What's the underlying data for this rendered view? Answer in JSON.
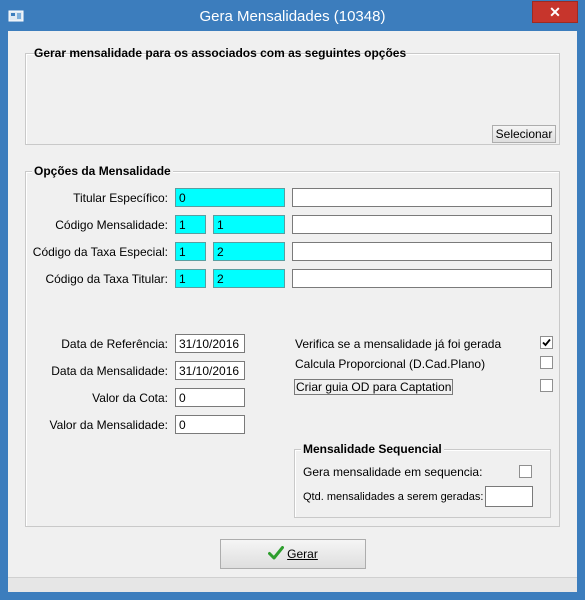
{
  "window": {
    "title": "Gera Mensalidades (10348)",
    "close_glyph": "✕"
  },
  "group_associados": {
    "legend": "Gerar mensalidade para os associados com as seguintes opções",
    "selecionar_label": "Selecionar"
  },
  "group_opcoes": {
    "legend": "Opções da Mensalidade",
    "titular": {
      "label": "Titular Específico:",
      "value": "0",
      "desc": ""
    },
    "codigo_mensalidade": {
      "label": "Código Mensalidade:",
      "value1": "1",
      "value2": "1",
      "desc": ""
    },
    "codigo_taxa_especial": {
      "label": "Código da Taxa Especial:",
      "value1": "1",
      "value2": "2",
      "desc": ""
    },
    "codigo_taxa_titular": {
      "label": "Código da Taxa Titular:",
      "value1": "1",
      "value2": "2",
      "desc": ""
    },
    "data_referencia": {
      "label": "Data de Referência:",
      "value": "31/10/2016"
    },
    "data_mensalidade": {
      "label": "Data da Mensalidade:",
      "value": "31/10/2016"
    },
    "valor_cota": {
      "label": "Valor da Cota:",
      "value": "0"
    },
    "valor_mensalidade": {
      "label": "Valor da Mensalidade:",
      "value": "0"
    },
    "checks": {
      "verifica": {
        "label": "Verifica se a mensalidade já foi gerada",
        "checked": true
      },
      "proporcional": {
        "label": "Calcula Proporcional (D.Cad.Plano)",
        "checked": false
      },
      "captation": {
        "label": "Criar guia OD para Captation",
        "checked": false
      }
    }
  },
  "group_sequencial": {
    "legend": "Mensalidade Sequencial",
    "gera_label": "Gera mensalidade em sequencia:",
    "gera_checked": false,
    "qtd_label": "Qtd. mensalidades a serem geradas:",
    "qtd_value": ""
  },
  "footer": {
    "gerar_label": "Gerar"
  },
  "colors": {
    "titlebar": "#3c7dbd",
    "cyan_field": "#00ffff",
    "check_green": "#2e9e2e"
  }
}
